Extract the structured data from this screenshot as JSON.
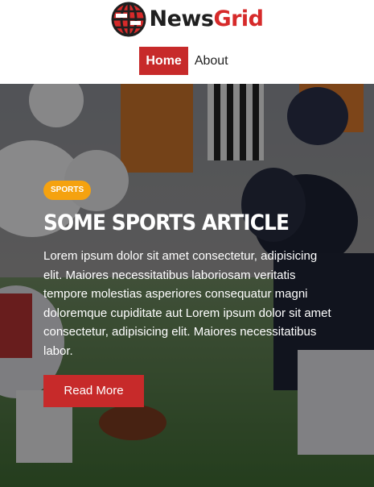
{
  "brand": {
    "name_part1": "News",
    "name_part2": "Grid",
    "accent": "#d62a2a",
    "logo_icon": "globe-icon"
  },
  "nav": {
    "items": [
      {
        "label": "Home",
        "active": true
      },
      {
        "label": "About",
        "active": false
      }
    ],
    "active_color": "#c72a2a"
  },
  "hero": {
    "background": "football-lineup-photo",
    "category": "SPORTS",
    "category_color": "#f5a20f",
    "title": "SOME SPORTS ARTICLE",
    "excerpt": "Lorem ipsum dolor sit amet consectetur, adipisicing elit. Maiores necessitatibus laboriosam veritatis tempore molestias asperiores consequatur magni doloremque cupiditate aut Lorem ipsum dolor sit amet consectetur, adipisicing elit. Maiores necessitatibus labor.",
    "cta_label": "Read More"
  }
}
